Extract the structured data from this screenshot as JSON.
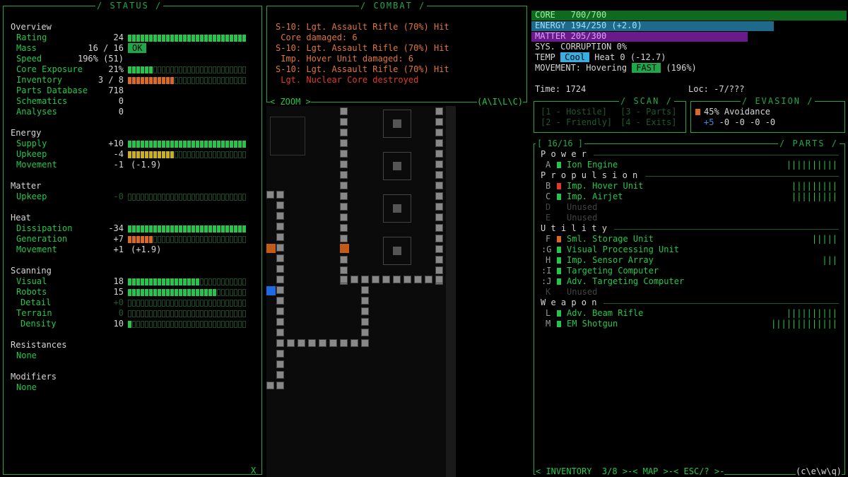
{
  "status": {
    "title": "STATUS",
    "close": "X",
    "sections": [
      {
        "name": "Overview",
        "rows": [
          {
            "label": "Rating",
            "value": "24"
          },
          {
            "label": "Mass",
            "value": "16 / 16",
            "badge": "OK"
          },
          {
            "label": "Speed",
            "value": "196% (51)"
          },
          {
            "label": "Core Exposure",
            "value": "21%"
          },
          {
            "label": "Inventory",
            "value": "3 / 8"
          },
          {
            "label": "Parts Database",
            "value": "718"
          },
          {
            "label": "Schematics",
            "value": "0"
          },
          {
            "label": "Analyses",
            "value": "0"
          }
        ]
      },
      {
        "name": "Energy",
        "rows": [
          {
            "label": "Supply",
            "value": "+10"
          },
          {
            "label": "Upkeep",
            "value": "-4"
          },
          {
            "label": "Movement",
            "value": "-1",
            "extra": "(-1.9)"
          }
        ]
      },
      {
        "name": "Matter",
        "rows": [
          {
            "label": "Upkeep",
            "value": "-0"
          }
        ]
      },
      {
        "name": "Heat",
        "rows": [
          {
            "label": "Dissipation",
            "value": "-34"
          },
          {
            "label": "Generation",
            "value": "+7"
          },
          {
            "label": "Movement",
            "value": "+1",
            "extra": "(+1.9)"
          }
        ]
      },
      {
        "name": "Scanning",
        "rows": [
          {
            "label": "Visual",
            "value": "18"
          },
          {
            "label": "Robots",
            "value": "15"
          },
          {
            "label": "Detail",
            "value": "+0"
          },
          {
            "label": "Terrain",
            "value": "0"
          },
          {
            "label": "Density",
            "value": "10"
          }
        ]
      },
      {
        "name": "Resistances",
        "rows": [
          {
            "label": "None",
            "value": ""
          }
        ]
      },
      {
        "name": "Modifiers",
        "rows": [
          {
            "label": "None",
            "value": ""
          }
        ]
      }
    ],
    "bars": {
      "rating": 1.0,
      "core_exposure": 0.21,
      "inventory": 0.375,
      "supply": 1.0,
      "upkeep": 0.4,
      "matter_upkeep": 0,
      "dissipation": 1.0,
      "generation": 0.2,
      "visual": 0.6,
      "robots": 0.75,
      "detail": 0,
      "terrain": 0,
      "density": 0.03
    }
  },
  "combat": {
    "title": "COMBAT",
    "lines": [
      {
        "text": "S-10: Lgt. Assault Rifle (70%) Hit",
        "color": "orange"
      },
      {
        "text": " Core damaged: 6",
        "color": "orange"
      },
      {
        "text": "S-10: Lgt. Assault Rifle (70%) Hit",
        "color": "orange"
      },
      {
        "text": " Imp. Hover Unit damaged: 6",
        "color": "orange"
      },
      {
        "text": "S-10: Lgt. Assault Rifle (70%) Hit",
        "color": "orange"
      },
      {
        "text": " Lgt. Nuclear Core destroyed",
        "color": "red"
      }
    ],
    "footer_left": "< ZOOM >",
    "footer_right": "(A\\I\\L\\C)"
  },
  "core": {
    "core_label": "CORE",
    "core_value": "700/700",
    "core_fill": 1.0,
    "energy_label": "ENERGY",
    "energy_value": "194/250",
    "energy_extra": "(+2.0)",
    "energy_fill": 0.776,
    "matter_label": "MATTER",
    "matter_value": "205/300",
    "matter_fill": 0.683,
    "corruption": "SYS. CORRUPTION 0%",
    "temp_label": "TEMP",
    "temp_badge": "Cool",
    "heat": "Heat 0 (-12.7)",
    "movement_label": "MOVEMENT: Hovering",
    "movement_badge": "FAST",
    "movement_extra": "(196%)",
    "time": "Time: 1724",
    "loc": "Loc: -7/???",
    "colors": {
      "core": "#0d6a1f",
      "energy": "#1f6a8a",
      "matter": "#6a1a8a"
    }
  },
  "scan": {
    "title": "SCAN",
    "items": [
      "[1 - Hostile]",
      "[3 - Parts]",
      "[2 - Friendly]",
      "[4 - Exits]"
    ]
  },
  "evasion": {
    "title": "EVASION",
    "avoidance": "45% Avoidance",
    "breakdown": "+5 -0 -0 -0 -0"
  },
  "parts": {
    "title": "PARTS",
    "count": "[ 16/16 ]",
    "groups": [
      {
        "name": "P o w e r",
        "items": [
          {
            "key": "A",
            "name": "Ion Engine",
            "state": "green",
            "ticks": "||||||||||"
          }
        ]
      },
      {
        "name": "P r o p u l s i o n",
        "items": [
          {
            "key": "B",
            "name": "Imp. Hover Unit",
            "state": "red",
            "ticks": "|||||||||"
          },
          {
            "key": "C",
            "name": "Imp. Airjet",
            "state": "green",
            "ticks": "|||||||||"
          },
          {
            "key": "D",
            "name": "Unused",
            "state": "none",
            "ticks": ""
          },
          {
            "key": "E",
            "name": "Unused",
            "state": "none",
            "ticks": ""
          }
        ]
      },
      {
        "name": "U t i l i t y",
        "items": [
          {
            "key": "F",
            "name": "Sml. Storage Unit",
            "state": "orange",
            "ticks": "|||||"
          },
          {
            "key": ":G",
            "name": "Visual Processing Unit",
            "state": "green",
            "ticks": ""
          },
          {
            "key": "H",
            "name": "Imp. Sensor Array",
            "state": "green",
            "ticks": "|||"
          },
          {
            "key": ":I",
            "name": "Targeting Computer",
            "state": "green",
            "ticks": ""
          },
          {
            "key": ":J",
            "name": "Adv. Targeting Computer",
            "state": "green",
            "ticks": ""
          },
          {
            "key": "K",
            "name": "Unused",
            "state": "none",
            "ticks": ""
          }
        ]
      },
      {
        "name": "W e a p o n",
        "items": [
          {
            "key": "L",
            "name": "Adv. Beam Rifle",
            "state": "green",
            "ticks": "||||||||||"
          },
          {
            "key": "M",
            "name": "EM Shotgun",
            "state": "green",
            "ticks": "|||||||||||||"
          }
        ]
      }
    ],
    "footer": "< INVENTORY  3/8 >-< MAP >-< ESC/? >-",
    "footer_right": "(c\\e\\w\\q)"
  }
}
